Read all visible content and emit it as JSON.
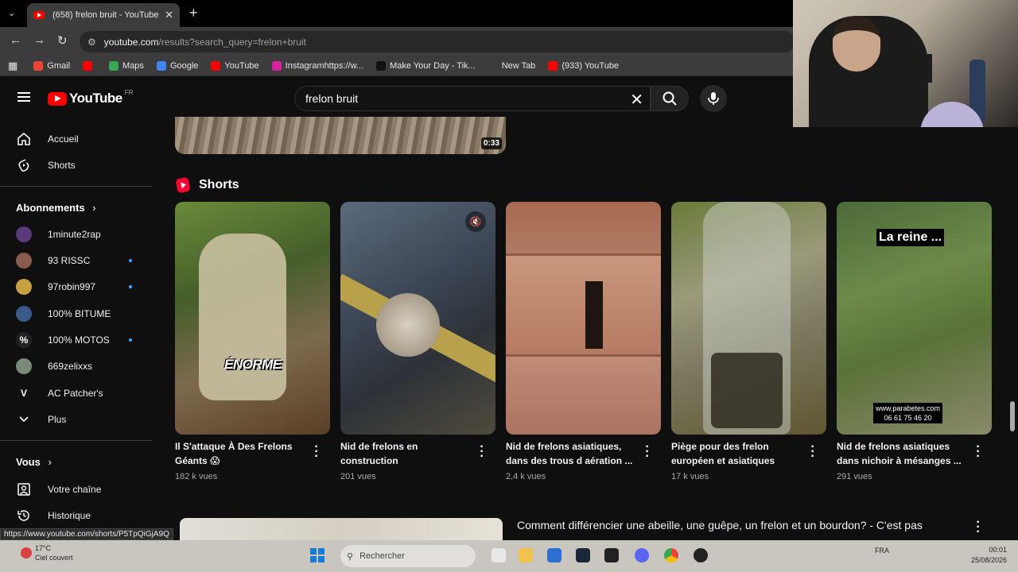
{
  "browser": {
    "tab_title": "(658) frelon bruit - YouTube",
    "url_host": "youtube.com",
    "url_path": "/results?search_query=frelon+bruit",
    "bookmarks": [
      {
        "label": "Gmail",
        "color": "#ea4335"
      },
      {
        "label": "",
        "color": "#ff0000"
      },
      {
        "label": "Maps",
        "color": "#34a853"
      },
      {
        "label": "Google",
        "color": "#4285f4"
      },
      {
        "label": "YouTube",
        "color": "#ff0000"
      },
      {
        "label": "Instagramhttps://w...",
        "color": "#d6249f"
      },
      {
        "label": "Make Your Day - Tik...",
        "color": "#111111"
      },
      {
        "label": "New Tab",
        "color": "#3c3c3c"
      },
      {
        "label": "(933) YouTube",
        "color": "#ff0000"
      }
    ]
  },
  "header": {
    "logo_text": "YouTube",
    "logo_country": "FR",
    "search_value": "frelon bruit"
  },
  "sidebar": {
    "main": [
      {
        "label": "Accueil",
        "icon": "home-icon"
      },
      {
        "label": "Shorts",
        "icon": "shorts-icon"
      }
    ],
    "subscriptions_title": "Abonnements",
    "subscriptions": [
      {
        "label": "1minute2rap",
        "color": "#5a3a7a",
        "dot": false
      },
      {
        "label": "93 RISSC",
        "color": "#8a5a4a",
        "dot": true
      },
      {
        "label": "97robin997",
        "color": "#c9a040",
        "dot": true
      },
      {
        "label": "100% BITUME",
        "color": "#3a5a8a",
        "dot": false
      },
      {
        "label": "100% MOTOS",
        "color": "#222222",
        "dot": true
      },
      {
        "label": "669zelixxs",
        "color": "#7a8a7a",
        "dot": false
      },
      {
        "label": "AC Patcher's",
        "color": "#111111",
        "dot": false
      },
      {
        "label": "Plus",
        "color": "",
        "dot": false
      }
    ],
    "you_title": "Vous",
    "you": [
      {
        "label": "Votre chaîne",
        "icon": "channel-icon"
      },
      {
        "label": "Historique",
        "icon": "history-icon"
      }
    ]
  },
  "main": {
    "prev_duration": "0:33",
    "shorts_title": "Shorts",
    "shorts": [
      {
        "title": "Il S'attaque À Des Frelons Géants 😱",
        "views": "182 k vues",
        "overlay": "ÉNORME"
      },
      {
        "title": "Nid de frelons en construction",
        "views": "201 vues",
        "overlay": ""
      },
      {
        "title": "Nid de frelons asiatiques, dans des trous d aération ...",
        "views": "2,4 k vues",
        "overlay": ""
      },
      {
        "title": "Piège pour des frelon européen et asiatiques",
        "views": "17 k vues",
        "overlay": ""
      },
      {
        "title": "Nid de frelons asiatiques dans nichoir à mésanges ...",
        "views": "291 vues",
        "overlay": "La reine ...",
        "overlay2": "www.parabetes.com",
        "overlay3": "06 61 75 46 20"
      }
    ],
    "next_title": "Comment différencier une abeille, une guêpe, un frelon et un bourdon? - C'est pas"
  },
  "status_url": "https://www.youtube.com/shorts/P5TpQiGjA9Q",
  "taskbar": {
    "temp": "17°C",
    "weather": "Ciel couvert",
    "search_placeholder": "Rechercher",
    "lang": "FRA",
    "time": "00:01",
    "date": "25/08/2026"
  }
}
